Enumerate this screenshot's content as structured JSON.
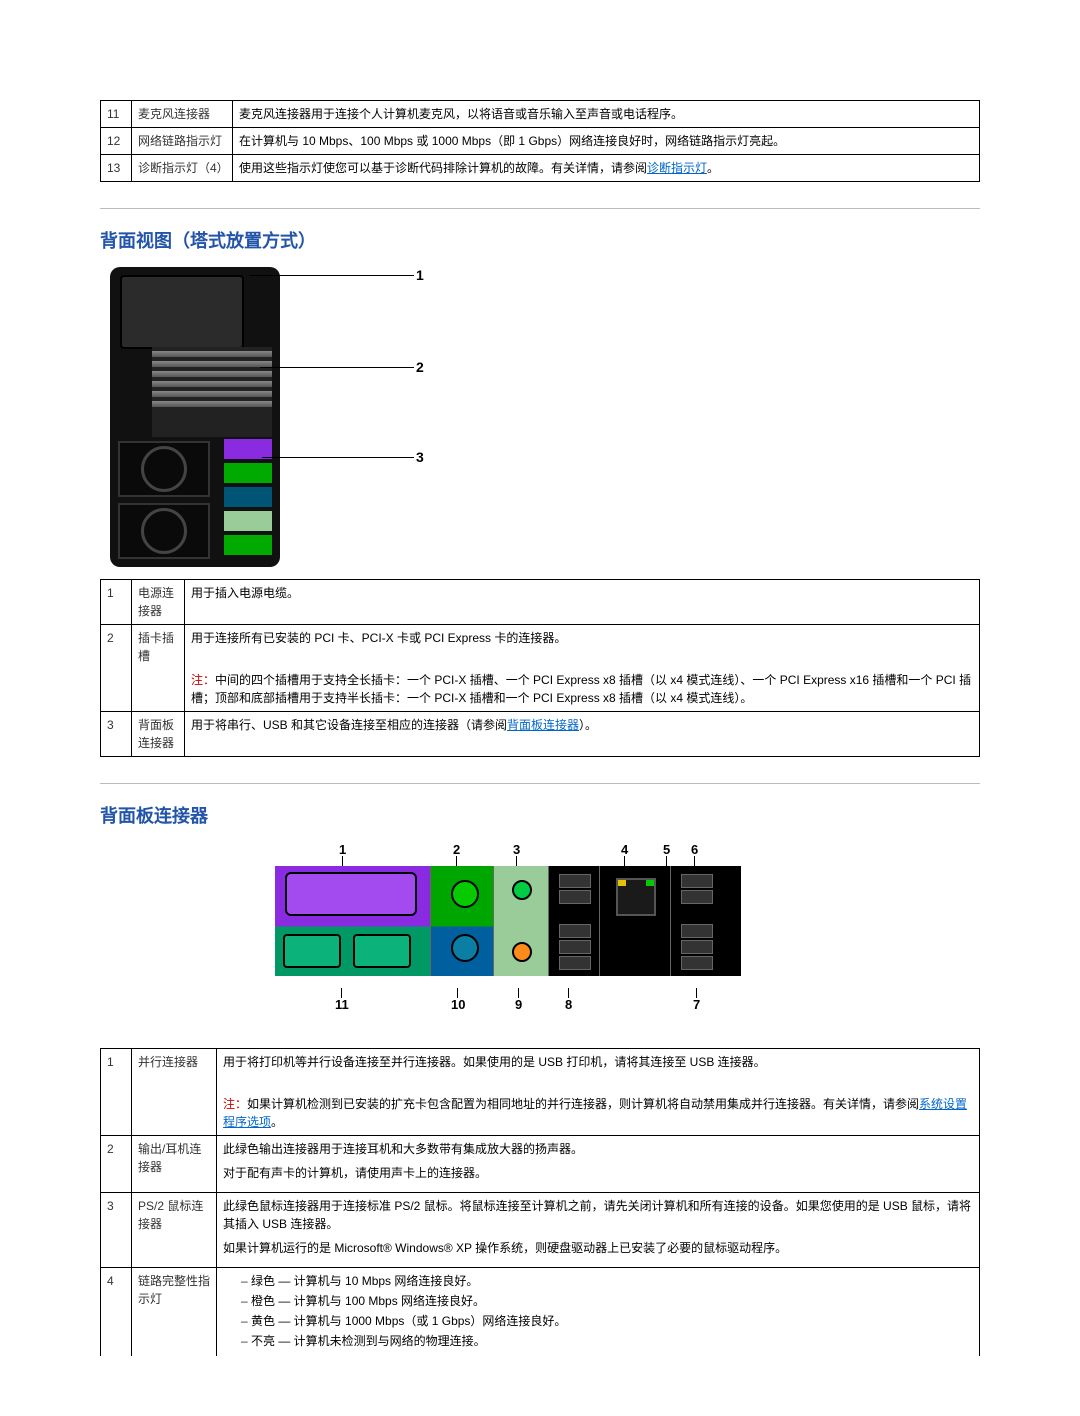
{
  "top_table": [
    {
      "num": "11",
      "name": "麦克风连接器",
      "desc": "麦克风连接器用于连接个人计算机麦克风，以将语音或音乐输入至声音或电话程序。"
    },
    {
      "num": "12",
      "name": "网络链路指示灯",
      "desc": "在计算机与 10 Mbps、100 Mbps 或 1000 Mbps（即 1 Gbps）网络连接良好时，网络链路指示灯亮起。"
    },
    {
      "num": "13",
      "name": "诊断指示灯（4）",
      "desc_pre": "使用这些指示灯使您可以基于诊断代码排除计算机的故障。有关详情，请参阅",
      "link": "诊断指示灯",
      "desc_post": "。"
    }
  ],
  "section1_title": "背面视图（塔式放置方式）",
  "callouts": {
    "c1": "1",
    "c2": "2",
    "c3": "3"
  },
  "back_table": [
    {
      "num": "1",
      "name": "电源连接器",
      "desc": "用于插入电源电缆。"
    },
    {
      "num": "2",
      "name": "插卡插槽",
      "desc": "用于连接所有已安装的 PCI 卡、PCI-X 卡或 PCI Express 卡的连接器。",
      "note_label": "注：",
      "note": "中间的四个插槽用于支持全长插卡：一个 PCI-X 插槽、一个 PCI Express x8 插槽（以 x4 模式连线）、一个 PCI Express x16 插槽和一个 PCI 插槽；顶部和底部插槽用于支持半长插卡：一个 PCI-X 插槽和一个 PCI Express x8 插槽（以 x4 模式连线）。"
    },
    {
      "num": "3",
      "name": "背面板连接器",
      "desc_pre": "用于将串行、USB 和其它设备连接至相应的连接器（请参阅",
      "link": "背面板连接器",
      "desc_post": "）。"
    }
  ],
  "section2_title": "背面板连接器",
  "panel_labels_top": {
    "1": "1",
    "2": "2",
    "3": "3",
    "4": "4",
    "5": "5",
    "6": "6"
  },
  "panel_labels_bot": {
    "11": "11",
    "10": "10",
    "9": "9",
    "8": "8",
    "7": "7"
  },
  "conn_table": [
    {
      "num": "1",
      "name": "并行连接器",
      "desc": "用于将打印机等并行设备连接至并行连接器。如果使用的是 USB 打印机，请将其连接至 USB 连接器。",
      "note_label": "注：",
      "note_pre": "如果计算机检测到已安装的扩充卡包含配置为相同地址的并行连接器，则计算机将自动禁用集成并行连接器。有关详情，请参阅",
      "note_link": "系统设置程序选项",
      "note_post": "。"
    },
    {
      "num": "2",
      "name": "输出/耳机连接器",
      "desc": "此绿色输出连接器用于连接耳机和大多数带有集成放大器的扬声器。",
      "desc2": "对于配有声卡的计算机，请使用声卡上的连接器。"
    },
    {
      "num": "3",
      "name": "PS/2 鼠标连接器",
      "desc": "此绿色鼠标连接器用于连接标准 PS/2 鼠标。将鼠标连接至计算机之前，请先关闭计算机和所有连接的设备。如果您使用的是 USB 鼠标，请将其插入 USB 连接器。",
      "desc2": "如果计算机运行的是 Microsoft® Windows® XP 操作系统，则硬盘驱动器上已安装了必要的鼠标驱动程序。"
    },
    {
      "num": "4",
      "name": "链路完整性指示灯",
      "bullets": [
        "绿色 — 计算机与 10 Mbps 网络连接良好。",
        "橙色 — 计算机与 100 Mbps 网络连接良好。",
        "黄色 — 计算机与 1000 Mbps（或 1 Gbps）网络连接良好。",
        "不亮 — 计算机未检测到与网络的物理连接。"
      ]
    }
  ]
}
